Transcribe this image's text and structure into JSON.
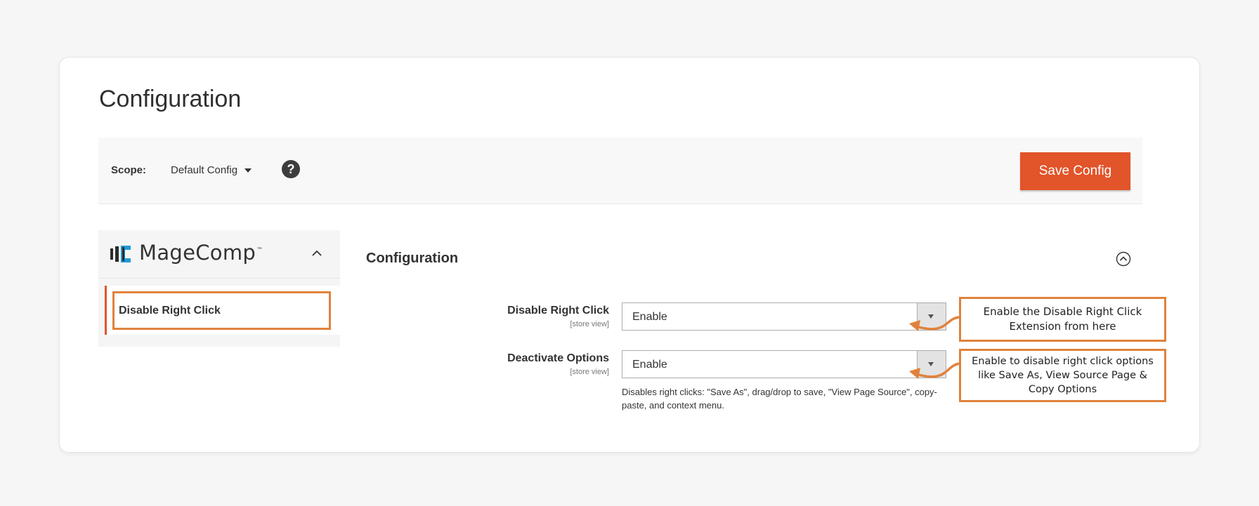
{
  "page": {
    "title": "Configuration"
  },
  "scope": {
    "label": "Scope:",
    "value": "Default Config",
    "help_symbol": "?"
  },
  "toolbar": {
    "save_label": "Save Config"
  },
  "sidebar": {
    "brand": "MageComp",
    "brand_tm": "™",
    "items": [
      {
        "label": "Disable Right Click"
      }
    ]
  },
  "section": {
    "title": "Configuration",
    "fields": [
      {
        "label": "Disable Right Click",
        "scope": "[store view]",
        "value": "Enable"
      },
      {
        "label": "Deactivate Options",
        "scope": "[store view]",
        "value": "Enable",
        "note": "Disables right clicks: \"Save As\", drag/drop to save, \"View Page Source\", copy-paste, and context menu."
      }
    ]
  },
  "callouts": [
    {
      "text": "Enable the Disable Right Click Extension from here"
    },
    {
      "text": "Enable to disable right click options like Save As, View Source Page & Copy Options"
    }
  ],
  "colors": {
    "accent": "#e2542a",
    "annotation": "#e0823c"
  }
}
